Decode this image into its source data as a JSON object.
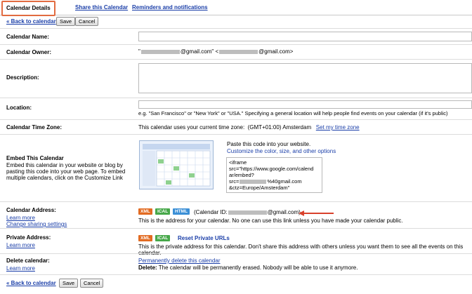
{
  "tabs": [
    {
      "label": "Calendar Details"
    },
    {
      "label": "Share this Calendar"
    },
    {
      "label": "Reminders and notifications"
    }
  ],
  "nav": {
    "back": "« Back to calendar",
    "save": "Save",
    "cancel": "Cancel"
  },
  "fields": {
    "name": {
      "label": "Calendar Name:"
    },
    "owner": {
      "label": "Calendar Owner:",
      "value_a": "\"",
      "value_b": "@gmail.com\"",
      "value_c": "<",
      "value_d": "@gmail.com>"
    },
    "description": {
      "label": "Description:"
    },
    "location": {
      "label": "Location:",
      "hint": "e.g. \"San Francisco\" or \"New York\" or \"USA.\" Specifying a general location will help people find events on your calendar (if it's public)"
    },
    "timezone": {
      "label": "Calendar Time Zone:",
      "text": "This calendar uses your current time zone:",
      "zone": "(GMT+01:00) Amsterdam",
      "link": "Set my time zone"
    },
    "embed": {
      "label": "Embed This Calendar",
      "desc": "Embed this calendar in your website or blog by pasting this code into your web page. To embed multiple calendars, click on the Customize Link",
      "paste": "Paste this code into your website.",
      "customize": "Customize the color, size, and other options",
      "code_1": "<iframe",
      "code_2": "src=\"https://www.google.com/calend",
      "code_3": "ar/embed?",
      "code_4": "src=",
      "code_5": "%40gmail.com",
      "code_6": "&ctz=Europe/Amsterdam\""
    },
    "address": {
      "label": "Calendar Address:",
      "learn": "Learn more",
      "change": "Change sharing settings",
      "calid_a": "(Calendar ID:",
      "calid_b": "@gmail.com)",
      "note": "This is the address for your calendar. No one can use this link unless you have made your calendar public."
    },
    "private": {
      "label": "Private Address:",
      "learn": "Learn more",
      "reset": "Reset Private URLs",
      "note": "This is the private address for this calendar. Don't share this address with others unless you want them to see all the events on this calendar."
    },
    "delete": {
      "label": "Delete calendar:",
      "learn": "Learn more",
      "link": "Permanently delete this calendar",
      "warn_bold": "Delete:",
      "warn": "The calendar will be permanently erased. Nobody will be able to use it anymore."
    }
  },
  "badges": {
    "xml": "XML",
    "ical": "ICAL",
    "html": "HTML"
  },
  "colors": {
    "tab_highlight": "#e26b40",
    "link": "#1a3ea8",
    "arrow": "#d9412c"
  }
}
